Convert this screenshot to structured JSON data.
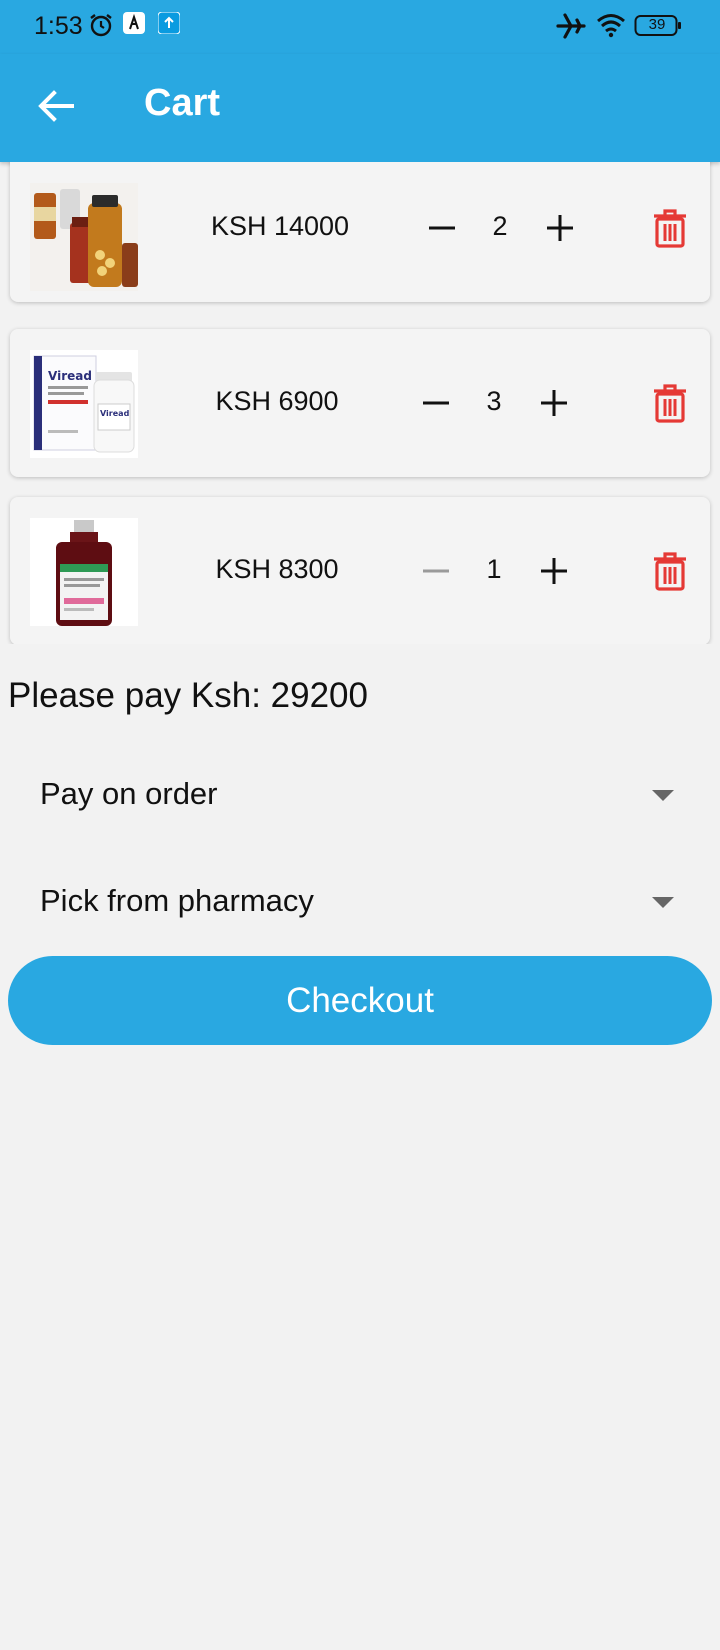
{
  "status_bar": {
    "time": "1:53",
    "battery": "39",
    "icons": [
      "alarm-icon",
      "app-notification-icon",
      "upload-icon",
      "airplane-mode-icon",
      "wifi-icon",
      "battery-icon"
    ]
  },
  "appbar": {
    "title": "Cart",
    "back_icon": "arrow-left-icon",
    "background": "#29a8e1"
  },
  "cart": {
    "items": [
      {
        "image": "pill-bottles",
        "price": "KSH 14000",
        "quantity": "2",
        "decrease_enabled": true
      },
      {
        "image": "viread-box",
        "price": "KSH 6900",
        "quantity": "3",
        "decrease_enabled": true
      },
      {
        "image": "syrup-bottle",
        "price": "KSH 8300",
        "quantity": "1",
        "decrease_enabled": false
      }
    ],
    "delete_icon": "trash-icon",
    "delete_color": "#e53935"
  },
  "summary": {
    "total_text": "Please pay Ksh: 29200"
  },
  "payment_select": {
    "value": "Pay on order"
  },
  "delivery_select": {
    "value": "Pick from pharmacy"
  },
  "checkout": {
    "label": "Checkout",
    "color": "#29a8e1"
  }
}
